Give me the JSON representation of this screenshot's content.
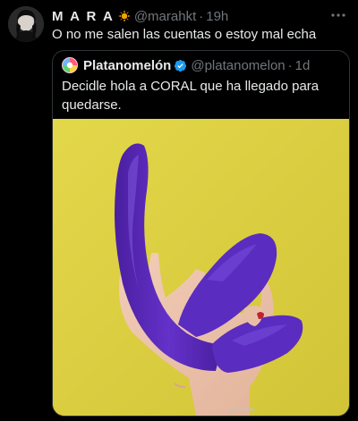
{
  "tweet": {
    "author_name": "M A R A",
    "author_handle": "@marahkt",
    "separator": "·",
    "time": "19h",
    "text": "O no me salen las cuentas o estoy mal echa",
    "name_emoji": "sun-emoji-icon",
    "more_icon": "more-options-icon"
  },
  "quoted_tweet": {
    "author_name": "Platanomelón",
    "author_handle": "@platanomelon",
    "separator": "·",
    "time": "1d",
    "verified_icon": "verified-badge-icon",
    "text": "Decidle hola a CORAL que ha llegado para quedarse.",
    "media": {
      "background_color": "#ddd03f",
      "product_color": "#5b2bb8"
    }
  },
  "colors": {
    "background": "#000000",
    "primary_text": "#e7e9ea",
    "secondary_text": "#71767b",
    "border": "#2f3336",
    "verified": "#1d9bf0"
  }
}
